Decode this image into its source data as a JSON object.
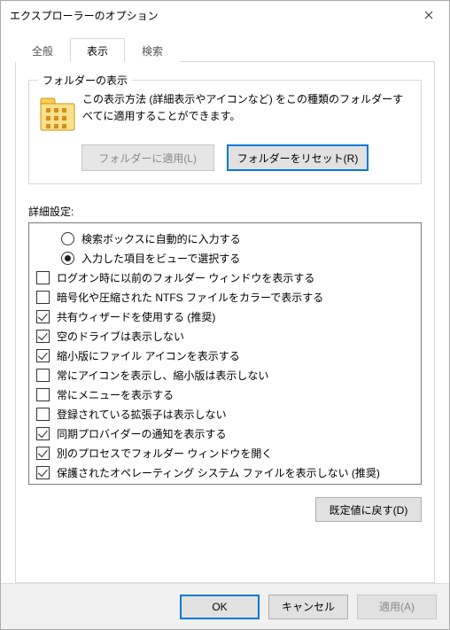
{
  "window": {
    "title": "エクスプローラーのオプション"
  },
  "tabs": {
    "general": "全般",
    "view": "表示",
    "search": "検索"
  },
  "folderDisplay": {
    "group_title": "フォルダーの表示",
    "description": "この表示方法 (詳細表示やアイコンなど) をこの種類のフォルダーすべてに適用することができます。",
    "apply_button": "フォルダーに適用(L)",
    "reset_button": "フォルダーをリセット(R)"
  },
  "advanced": {
    "label": "詳細設定:",
    "options": [
      {
        "kind": "radio",
        "indent": 1,
        "checked": false,
        "label": "検索ボックスに自動的に入力する"
      },
      {
        "kind": "radio",
        "indent": 1,
        "checked": true,
        "label": "入力した項目をビューで選択する"
      },
      {
        "kind": "checkbox",
        "indent": 0,
        "checked": false,
        "label": "ログオン時に以前のフォルダー ウィンドウを表示する"
      },
      {
        "kind": "checkbox",
        "indent": 0,
        "checked": false,
        "label": "暗号化や圧縮された NTFS ファイルをカラーで表示する"
      },
      {
        "kind": "checkbox",
        "indent": 0,
        "checked": true,
        "label": "共有ウィザードを使用する (推奨)"
      },
      {
        "kind": "checkbox",
        "indent": 0,
        "checked": true,
        "label": "空のドライブは表示しない"
      },
      {
        "kind": "checkbox",
        "indent": 0,
        "checked": true,
        "label": "縮小版にファイル アイコンを表示する"
      },
      {
        "kind": "checkbox",
        "indent": 0,
        "checked": false,
        "label": "常にアイコンを表示し、縮小版は表示しない"
      },
      {
        "kind": "checkbox",
        "indent": 0,
        "checked": false,
        "label": "常にメニューを表示する"
      },
      {
        "kind": "checkbox",
        "indent": 0,
        "checked": false,
        "label": "登録されている拡張子は表示しない"
      },
      {
        "kind": "checkbox",
        "indent": 0,
        "checked": true,
        "label": "同期プロバイダーの通知を表示する"
      },
      {
        "kind": "checkbox",
        "indent": 0,
        "checked": true,
        "label": "別のプロセスでフォルダー ウィンドウを開く"
      },
      {
        "kind": "checkbox",
        "indent": 0,
        "checked": true,
        "label": "保護されたオペレーティング システム ファイルを表示しない (推奨)"
      }
    ],
    "restore_defaults": "既定値に戻す(D)"
  },
  "footer": {
    "ok": "OK",
    "cancel": "キャンセル",
    "apply": "適用(A)"
  }
}
